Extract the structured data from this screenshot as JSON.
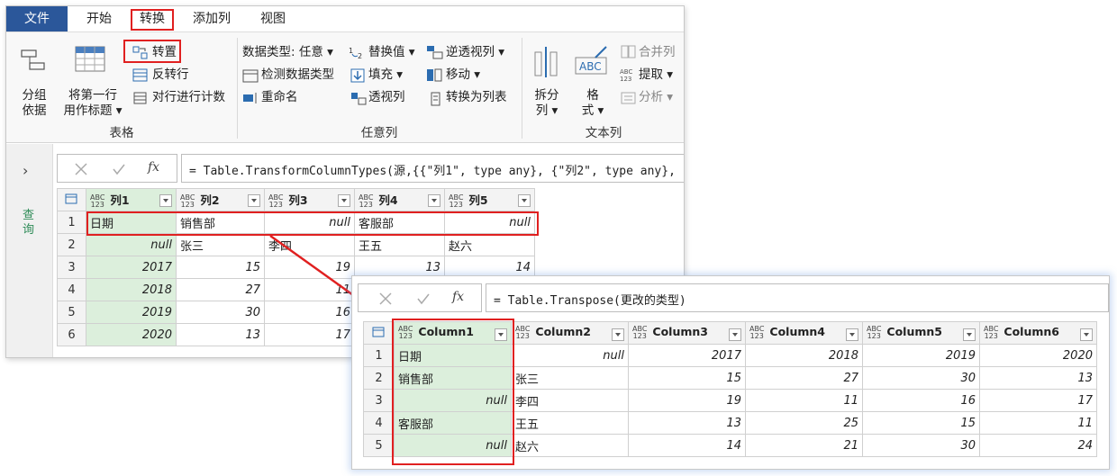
{
  "tabs": [
    "文件",
    "开始",
    "转换",
    "添加列",
    "视图"
  ],
  "ribbon": {
    "table_group": {
      "group_by": [
        "分组",
        "依据"
      ],
      "use_first_row": [
        "将第一行",
        "用作标题 ▾"
      ],
      "transpose": "转置",
      "reverse_rows": "反转行",
      "count_rows": "对行进行计数",
      "label": "表格"
    },
    "any_column_group": {
      "data_type": "数据类型: 任意 ▾",
      "detect_type": "检测数据类型",
      "rename": "重命名",
      "replace_values": "替换值 ▾",
      "fill": "填充 ▾",
      "pivot": "透视列",
      "unpivot": "逆透视列 ▾",
      "move": "移动 ▾",
      "convert_to_list": "转换为列表",
      "label": "任意列"
    },
    "text_column_group": {
      "split": [
        "拆分",
        "列 ▾"
      ],
      "format": [
        "格",
        "式 ▾"
      ],
      "merge": "合并列",
      "extract": "提取 ▾",
      "parse": "分析 ▾",
      "label": "文本列"
    }
  },
  "query_pane_label": "查询",
  "formula1": "= Table.TransformColumnTypes(源,{{\"列1\", type any}, {\"列2\", type any},",
  "grid1": {
    "headers": [
      "列1",
      "列2",
      "列3",
      "列4",
      "列5"
    ],
    "rows": [
      [
        "1",
        "日期",
        "销售部",
        "null",
        "客服部",
        "null"
      ],
      [
        "2",
        "null",
        "张三",
        "李四",
        "王五",
        "赵六"
      ],
      [
        "3",
        "2017",
        "15",
        "19",
        "13",
        "14"
      ],
      [
        "4",
        "2018",
        "27",
        "11",
        "",
        ""
      ],
      [
        "5",
        "2019",
        "30",
        "16",
        "",
        ""
      ],
      [
        "6",
        "2020",
        "13",
        "17",
        "",
        ""
      ]
    ]
  },
  "formula2": "= Table.Transpose(更改的类型)",
  "grid2": {
    "headers": [
      "Column1",
      "Column2",
      "Column3",
      "Column4",
      "Column5",
      "Column6"
    ],
    "rows": [
      [
        "1",
        "日期",
        "null",
        "2017",
        "2018",
        "2019",
        "2020"
      ],
      [
        "2",
        "销售部",
        "张三",
        "15",
        "27",
        "30",
        "13"
      ],
      [
        "3",
        "null",
        "李四",
        "19",
        "11",
        "16",
        "17"
      ],
      [
        "4",
        "客服部",
        "王五",
        "13",
        "25",
        "15",
        "11"
      ],
      [
        "5",
        "null",
        "赵六",
        "14",
        "21",
        "30",
        "24"
      ]
    ]
  },
  "type_icon": [
    "ABC",
    "123"
  ],
  "fx_label": "fx"
}
